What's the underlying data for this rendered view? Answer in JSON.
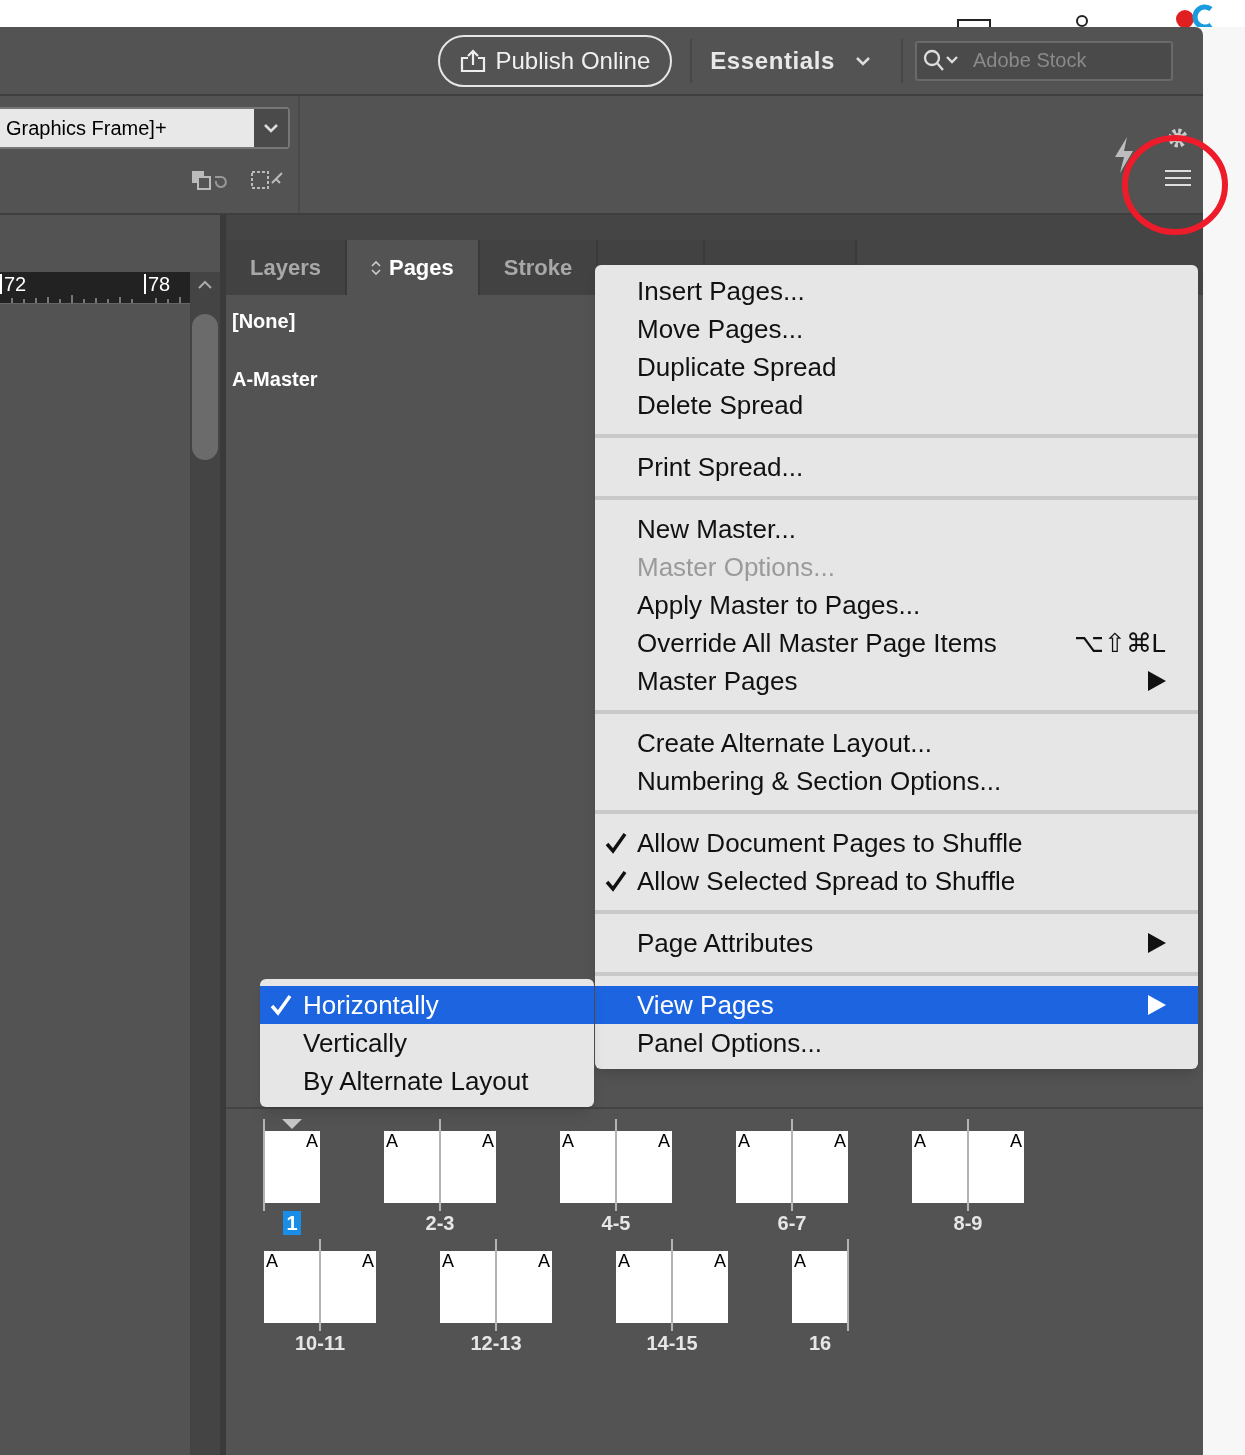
{
  "top_bar": {
    "publish_button": "Publish Online",
    "workspace": "Essentials",
    "search": {
      "placeholder": "Adobe Stock"
    }
  },
  "control_bar": {
    "object_style": "Graphics Frame]+"
  },
  "ruler": {
    "marks": [
      "72",
      "78"
    ]
  },
  "panel": {
    "tabs": [
      {
        "label": "Layers",
        "selected": false
      },
      {
        "label": "Pages",
        "selected": true
      },
      {
        "label": "Stroke",
        "selected": false
      }
    ],
    "masters": [
      "[None]",
      "A-Master"
    ],
    "spread_rows": [
      [
        {
          "label": "1",
          "selected": true,
          "current": true,
          "pages": [
            {
              "master": "A",
              "kind": "right"
            }
          ]
        },
        {
          "label": "2-3",
          "selected": false,
          "current": false,
          "pages": [
            {
              "master": "A",
              "kind": "left"
            },
            {
              "master": "A",
              "kind": "right"
            }
          ]
        },
        {
          "label": "4-5",
          "selected": false,
          "current": false,
          "pages": [
            {
              "master": "A",
              "kind": "left"
            },
            {
              "master": "A",
              "kind": "right"
            }
          ]
        },
        {
          "label": "6-7",
          "selected": false,
          "current": false,
          "pages": [
            {
              "master": "A",
              "kind": "left"
            },
            {
              "master": "A",
              "kind": "right"
            }
          ]
        },
        {
          "label": "8-9",
          "selected": false,
          "current": false,
          "pages": [
            {
              "master": "A",
              "kind": "left"
            },
            {
              "master": "A",
              "kind": "right"
            }
          ]
        }
      ],
      [
        {
          "label": "10-11",
          "selected": false,
          "current": false,
          "pages": [
            {
              "master": "A",
              "kind": "left"
            },
            {
              "master": "A",
              "kind": "right"
            }
          ]
        },
        {
          "label": "12-13",
          "selected": false,
          "current": false,
          "pages": [
            {
              "master": "A",
              "kind": "left"
            },
            {
              "master": "A",
              "kind": "right"
            }
          ]
        },
        {
          "label": "14-15",
          "selected": false,
          "current": false,
          "pages": [
            {
              "master": "A",
              "kind": "left"
            },
            {
              "master": "A",
              "kind": "right"
            }
          ]
        },
        {
          "label": "16",
          "selected": false,
          "current": false,
          "pages": [
            {
              "master": "A",
              "kind": "left"
            }
          ]
        }
      ]
    ]
  },
  "menu": {
    "sections": [
      [
        {
          "label": "Insert Pages...",
          "checked": false,
          "disabled": false,
          "submenu": false,
          "selected": false
        },
        {
          "label": "Move Pages...",
          "checked": false,
          "disabled": false,
          "submenu": false,
          "selected": false
        },
        {
          "label": "Duplicate Spread",
          "checked": false,
          "disabled": false,
          "submenu": false,
          "selected": false
        },
        {
          "label": "Delete Spread",
          "checked": false,
          "disabled": false,
          "submenu": false,
          "selected": false
        }
      ],
      [
        {
          "label": "Print Spread...",
          "checked": false,
          "disabled": false,
          "submenu": false,
          "selected": false
        }
      ],
      [
        {
          "label": "New Master...",
          "checked": false,
          "disabled": false,
          "submenu": false,
          "selected": false
        },
        {
          "label": "Master Options...",
          "checked": false,
          "disabled": true,
          "submenu": false,
          "selected": false
        },
        {
          "label": "Apply Master to Pages...",
          "checked": false,
          "disabled": false,
          "submenu": false,
          "selected": false
        },
        {
          "label": "Override All Master Page Items",
          "shortcut": "⌥⇧⌘L",
          "checked": false,
          "disabled": false,
          "submenu": false,
          "selected": false
        },
        {
          "label": "Master Pages",
          "checked": false,
          "disabled": false,
          "submenu": true,
          "selected": false
        }
      ],
      [
        {
          "label": "Create Alternate Layout...",
          "checked": false,
          "disabled": false,
          "submenu": false,
          "selected": false
        },
        {
          "label": "Numbering & Section Options...",
          "checked": false,
          "disabled": false,
          "submenu": false,
          "selected": false
        }
      ],
      [
        {
          "label": "Allow Document Pages to Shuffle",
          "checked": true,
          "disabled": false,
          "submenu": false,
          "selected": false
        },
        {
          "label": "Allow Selected Spread to Shuffle",
          "checked": true,
          "disabled": false,
          "submenu": false,
          "selected": false
        }
      ],
      [
        {
          "label": "Page Attributes",
          "checked": false,
          "disabled": false,
          "submenu": true,
          "selected": false
        }
      ],
      [
        {
          "label": "View Pages",
          "checked": false,
          "disabled": false,
          "submenu": true,
          "selected": true
        },
        {
          "label": "Panel Options...",
          "checked": false,
          "disabled": false,
          "submenu": false,
          "selected": false
        }
      ]
    ]
  },
  "submenu": {
    "items": [
      {
        "label": "Horizontally",
        "checked": true,
        "selected": true
      },
      {
        "label": "Vertically",
        "checked": false,
        "selected": false
      },
      {
        "label": "By Alternate Layout",
        "checked": false,
        "selected": false
      }
    ]
  }
}
